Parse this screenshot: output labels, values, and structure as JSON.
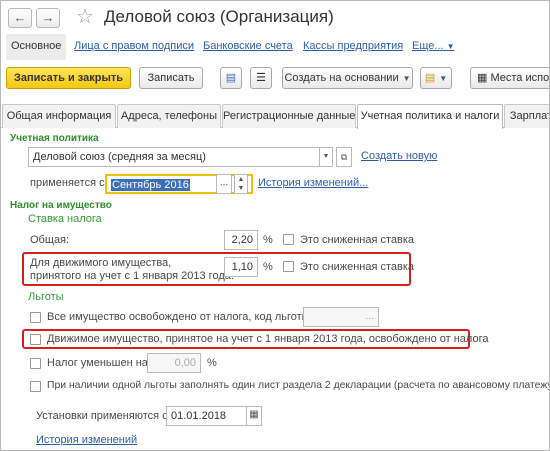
{
  "window": {
    "title": "Деловой союз (Организация)"
  },
  "nav": {
    "back": "←",
    "forward": "→",
    "tabs": [
      "Основное",
      "Лица с правом подписи",
      "Банковские счета",
      "Кассы предприятия",
      "Еще..."
    ]
  },
  "toolbar": {
    "save_close": "Записать и закрыть",
    "save": "Записать",
    "create_based": "Создать на основании",
    "places": "Места испо..."
  },
  "tabs": [
    "Общая информация",
    "Адреса, телефоны",
    "Регистрационные данные",
    "Учетная политика и налоги",
    "Зарплата"
  ],
  "policy": {
    "section": "Учетная политика",
    "value": "Деловой союз (средняя за месяц)",
    "create_new": "Создать новую",
    "applied_from_label": "применяется с:",
    "applied_from_value": "Сентябрь 2016",
    "history": "История изменений..."
  },
  "property_tax": {
    "section": "Налог на имущество",
    "rate_section": "Ставка налога",
    "general_label": "Общая:",
    "general_value": "2,20",
    "movable_label_1": "Для движимого имущества,",
    "movable_label_2": "принятого на учет с 1 января 2013 года:",
    "movable_value": "1,10",
    "percent": "%",
    "reduced_rate": "Это сниженная ставка",
    "benefits_section": "Льготы",
    "all_exempt": "Все имущество освобождено от налога, код льготы:",
    "movable_exempt": "Движимое имущество, принятое на учет с 1 января 2013 года, освобождено от налога",
    "tax_reduced": "Налог уменьшен на:",
    "tax_reduced_value": "0,00",
    "single_sheet": "При наличии одной льготы заполнять один лист раздела 2 декларации (расчета по авансовому платежу)",
    "settings_applied_label": "Установки применяются с:",
    "settings_applied_value": "01.01.2018",
    "history": "История изменений"
  },
  "colors": {
    "accent_yellow": "#f4c712",
    "section_green": "#2e8b2e",
    "link_blue": "#2f5ea8",
    "highlight_red": "#d42020"
  }
}
